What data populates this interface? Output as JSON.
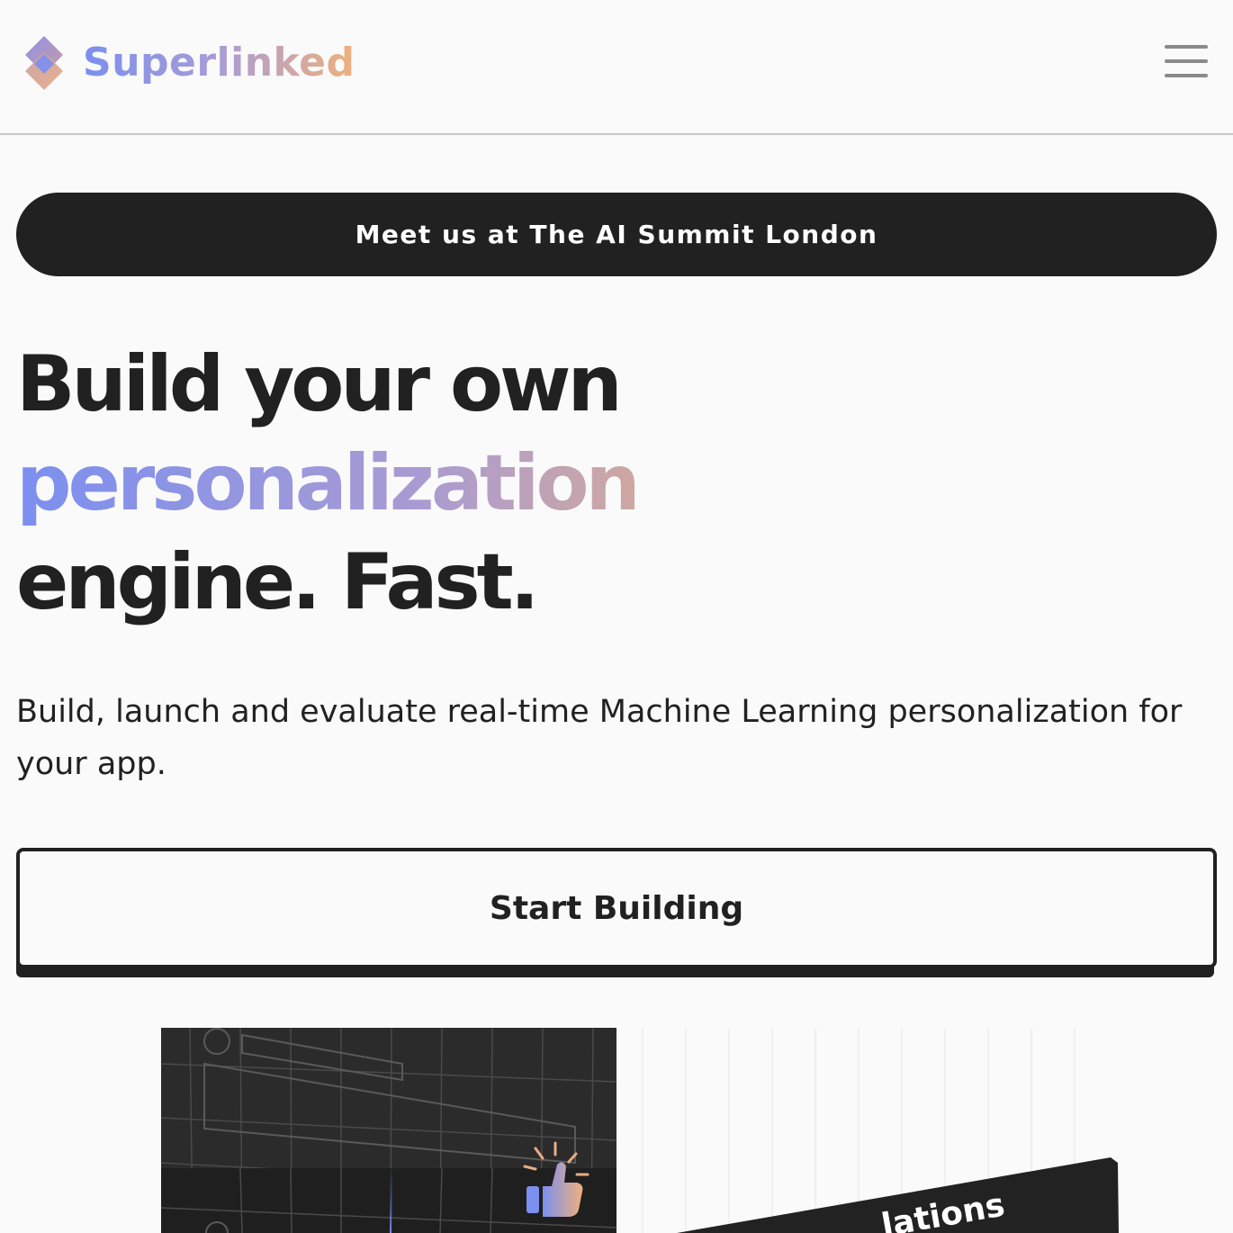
{
  "header": {
    "brand_name": "Superlinked",
    "logo_icon": "superlinked-diamond-icon",
    "menu_icon": "hamburger-menu-icon"
  },
  "banner": {
    "label": "Meet us at The AI Summit London"
  },
  "hero": {
    "title_line1": "Build your own",
    "title_line2": "personalization",
    "title_line3": "engine. Fast.",
    "subtitle": "Build, launch and evaluate real-time Machine Learning personalization for your app."
  },
  "cta": {
    "label": "Start Building"
  },
  "illustrations": {
    "left_icon": "thumbs-up-icon",
    "right_card_text": "lations"
  },
  "colors": {
    "text": "#212121",
    "background": "#fafafa",
    "gradient_start": "#7b8ff0",
    "gradient_end": "#f2b07e",
    "dark_surface": "#212121"
  }
}
